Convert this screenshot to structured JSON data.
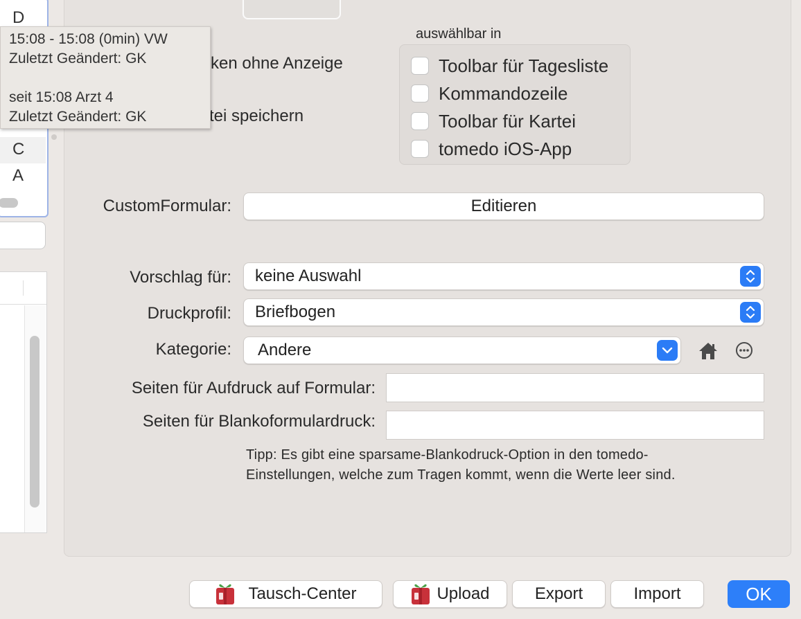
{
  "left_list": {
    "letters": [
      "D",
      "C",
      "A"
    ]
  },
  "tooltip": {
    "line1": "15:08 - 15:08 (0min)  VW",
    "line2": "Zuletzt Geändert: GK",
    "line3": "seit 15:08  Arzt  4",
    "line4": "Zuletzt Geändert: GK"
  },
  "options": {
    "print_without_display_partial": "cken ohne Anzeige",
    "save_in_record_partial": "rtei speichern"
  },
  "availability": {
    "title": "auswählbar in",
    "items": [
      {
        "label": "Toolbar für Tagesliste",
        "checked": false
      },
      {
        "label": "Kommandozeile",
        "checked": false
      },
      {
        "label": "Toolbar für Kartei",
        "checked": false
      },
      {
        "label": "tomedo iOS-App",
        "checked": false
      }
    ]
  },
  "form": {
    "custom_form_label": "CustomFormular:",
    "edit_button": "Editieren",
    "suggestion_label": "Vorschlag für:",
    "suggestion_value": "keine Auswahl",
    "print_profile_label": "Druckprofil:",
    "print_profile_value": "Briefbogen",
    "category_label": "Kategorie:",
    "category_value": "Andere",
    "pages_overprint_label": "Seiten für Aufdruck auf Formular:",
    "pages_overprint_value": "",
    "pages_blank_label": "Seiten für Blankoformulardruck:",
    "pages_blank_value": "",
    "tip_line1": "Tipp: Es gibt eine sparsame-Blankodruck-Option in den tomedo-",
    "tip_line2": "Einstellungen, welche zum Tragen kommt, wenn die Werte leer sind."
  },
  "icons": {
    "home": "home-icon",
    "more": "ellipsis-circle-icon",
    "gift": "gift-box-icon"
  },
  "footer": {
    "exchange_center": "Tausch-Center",
    "upload": "Upload",
    "export": "Export",
    "import": "Import",
    "ok": "OK"
  },
  "colors": {
    "accent": "#2d7ff9",
    "gift_red": "#c8313a"
  }
}
